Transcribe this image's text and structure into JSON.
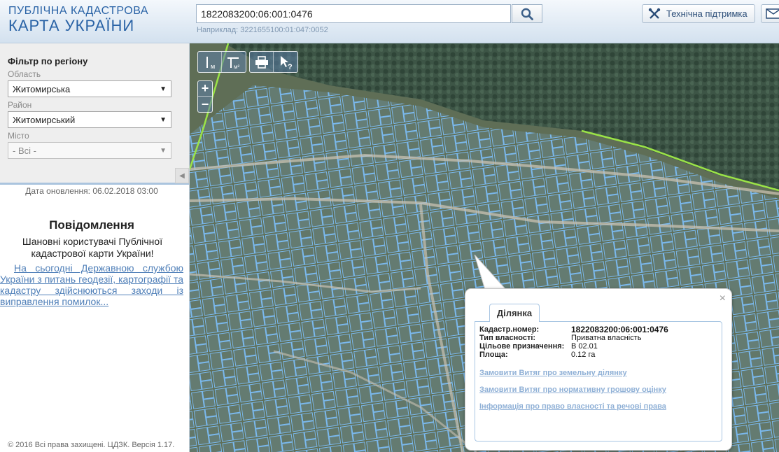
{
  "header": {
    "logo_line1": "ПУБЛІЧНА КАДАСТРОВА",
    "logo_line2": "КАРТА УКРАЇНИ",
    "search_value": "1822083200:06:001:0476",
    "search_hint": "Наприклад: 3221655100:01:047:0052",
    "support_label": "Технічна підтримка"
  },
  "sidebar": {
    "filter_title": "Фільтр по регіону",
    "oblast_label": "Область",
    "oblast_value": "Житомирська",
    "rayon_label": "Район",
    "rayon_value": "Житомирський",
    "misto_label": "Місто",
    "misto_value": "- Всі -",
    "update_text": "Дата оновлення: 06.02.2018 03:00",
    "notice_title": "Повідомлення",
    "notice_greeting": "Шановні користувачі Публічної кадастрової карти України!",
    "notice_link": "На сьогодні Державною службою України з питань геодезії, картографії та кадастру здійснюються заходи із виправлення помилок...",
    "copyright": "© 2016 Всі права захищені. ЦДЗК. Версія 1.17."
  },
  "map": {
    "toolbar": {
      "measure_line_unit": "м",
      "measure_area_unit": "м²",
      "identify_glyph": "?"
    },
    "zoom_in": "+",
    "zoom_out": "−"
  },
  "popup": {
    "close": "×",
    "tab": "Ділянка",
    "rows": [
      {
        "key": "Кадастр.номер:",
        "value": "1822083200:06:001:0476"
      },
      {
        "key": "Тип власності:",
        "value": "Приватна власність"
      },
      {
        "key": "Цільове призначення:",
        "value": "В 02.01"
      },
      {
        "key": "Площа:",
        "value": "0.12 га"
      }
    ],
    "links": [
      "Замовити Витяг про земельну ділянку",
      "Замовити Витяг про нормативну грошову оцінку",
      "Інформація про право власності та речові права"
    ]
  },
  "colors": {
    "brand": "#2a63a6",
    "parcel": "#7ab8ec",
    "link": "#4f7fb8",
    "popup_link": "#8fb0d6"
  }
}
